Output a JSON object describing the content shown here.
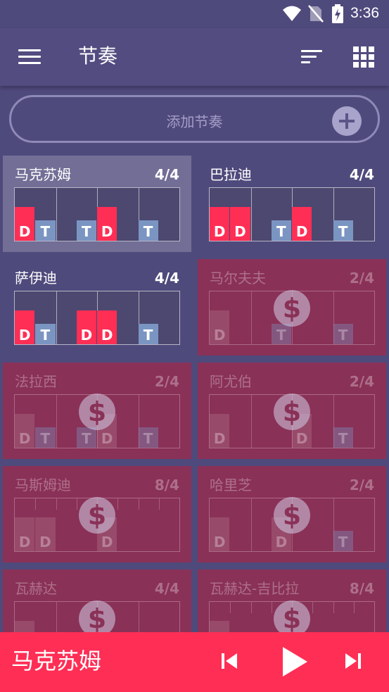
{
  "status_bar": {
    "time": "3:36",
    "icons": [
      "wifi-icon",
      "no-sim-icon",
      "battery-charging-icon"
    ]
  },
  "app_bar": {
    "title": "节奏",
    "menu_icon": "hamburger-menu-icon",
    "sort_icon": "sort-icon",
    "view_icon": "grid-view-icon"
  },
  "add_rhythm": {
    "label": "添加节奏",
    "icon": "plus-circle-icon"
  },
  "colors": {
    "background": "#4f4a7c",
    "accent": "#ff2e55",
    "tek": "#7b95c2",
    "locked": "#8a3157"
  },
  "rhythms": [
    {
      "name": "马克苏姆",
      "signature": "4/4",
      "selected": true,
      "locked": false,
      "beats": 4,
      "steps": [
        "D",
        "T",
        "",
        "T",
        "D",
        "",
        "T",
        ""
      ]
    },
    {
      "name": "巴拉迪",
      "signature": "4/4",
      "selected": false,
      "locked": false,
      "beats": 4,
      "steps": [
        "D",
        "D",
        "",
        "T",
        "D",
        "",
        "T",
        ""
      ]
    },
    {
      "name": "萨伊迪",
      "signature": "4/4",
      "selected": false,
      "locked": false,
      "beats": 4,
      "steps": [
        "D",
        "T",
        "",
        "D",
        "D",
        "",
        "T",
        ""
      ]
    },
    {
      "name": "马尔夫夫",
      "signature": "2/4",
      "selected": false,
      "locked": true,
      "beats": 4,
      "steps": [
        "D",
        "",
        "",
        "T",
        "",
        "",
        "T",
        ""
      ]
    },
    {
      "name": "法拉西",
      "signature": "2/4",
      "selected": false,
      "locked": true,
      "beats": 4,
      "steps": [
        "D",
        "T",
        "",
        "T",
        "D",
        "",
        "T",
        ""
      ]
    },
    {
      "name": "阿尤伯",
      "signature": "2/4",
      "selected": false,
      "locked": true,
      "beats": 4,
      "steps": [
        "D",
        "",
        "",
        "",
        "D",
        "",
        "T",
        ""
      ]
    },
    {
      "name": "马斯姆迪",
      "signature": "8/4",
      "selected": false,
      "locked": true,
      "beats": 8,
      "steps": [
        "D",
        "D",
        "",
        "",
        "D",
        "",
        "",
        ""
      ]
    },
    {
      "name": "哈里芝",
      "signature": "2/4",
      "selected": false,
      "locked": true,
      "beats": 4,
      "steps": [
        "D",
        "",
        "",
        "D",
        "",
        "",
        "T",
        ""
      ]
    },
    {
      "name": "瓦赫达",
      "signature": "4/4",
      "selected": false,
      "locked": true,
      "beats": 4,
      "steps": [
        "D",
        "",
        "",
        "",
        "",
        "",
        "",
        ""
      ]
    },
    {
      "name": "瓦赫达-吉比拉",
      "signature": "8/4",
      "selected": false,
      "locked": true,
      "beats": 8,
      "steps": [
        "D",
        "",
        "",
        "",
        "",
        "",
        "",
        ""
      ]
    }
  ],
  "player": {
    "current": "马克苏姆",
    "prev_icon": "skip-previous-icon",
    "play_icon": "play-icon",
    "next_icon": "skip-next-icon"
  }
}
